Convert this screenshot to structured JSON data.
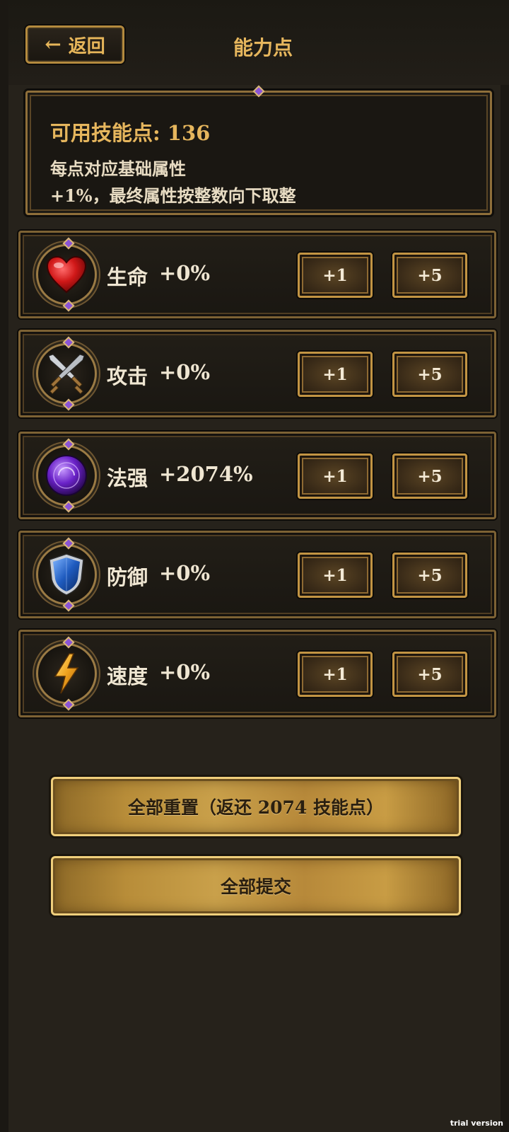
{
  "header": {
    "back_label": "返回",
    "title": "能力点"
  },
  "info": {
    "title": "可用技能点: 136",
    "line1": "每点对应基础属性",
    "line2": "+1%，最终属性按整数向下取整"
  },
  "stats": [
    {
      "label": "生命",
      "value": "+0%",
      "icon": "heart-icon",
      "btn1": "+1",
      "btn5": "+5"
    },
    {
      "label": "攻击",
      "value": "+0%",
      "icon": "crossed-swords-icon",
      "btn1": "+1",
      "btn5": "+5"
    },
    {
      "label": "法强",
      "value": "+2074%",
      "icon": "magic-orb-icon",
      "btn1": "+1",
      "btn5": "+5"
    },
    {
      "label": "防御",
      "value": "+0%",
      "icon": "shield-icon",
      "btn1": "+1",
      "btn5": "+5"
    },
    {
      "label": "速度",
      "value": "+0%",
      "icon": "lightning-icon",
      "btn1": "+1",
      "btn5": "+5"
    }
  ],
  "actions": {
    "reset_label": "全部重置（返还 2074 技能点）",
    "submit_label": "全部提交"
  },
  "watermark": "trial version",
  "colors": {
    "accent_gold": "#e6b65d",
    "background": "#26221b"
  }
}
